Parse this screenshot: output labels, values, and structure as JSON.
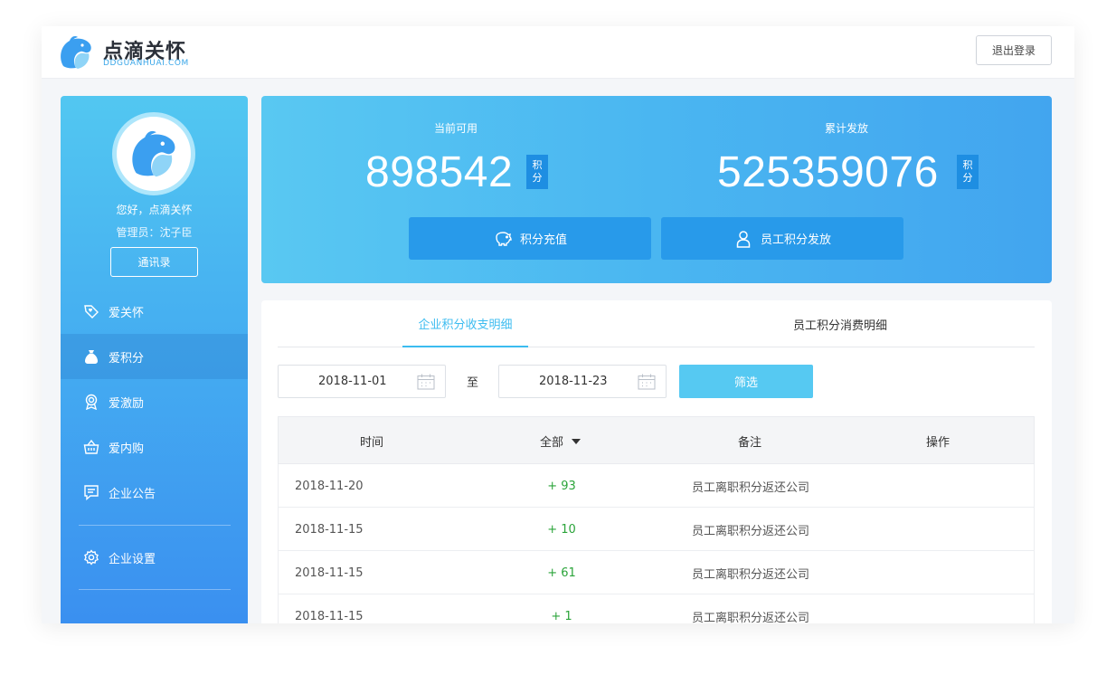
{
  "brand": {
    "name": "点滴关怀",
    "domain": "DDGUANHUAI.COM"
  },
  "header": {
    "logout_label": "退出登录"
  },
  "sidebar": {
    "greeting": "您好，点滴关怀",
    "admin": "管理员：沈子臣",
    "contacts_label": "通讯录",
    "items": [
      {
        "label": "爱关怀",
        "icon": "heart-tag-icon"
      },
      {
        "label": "爱积分",
        "icon": "money-bag-icon"
      },
      {
        "label": "爱激励",
        "icon": "medal-icon"
      },
      {
        "label": "爱内购",
        "icon": "basket-icon"
      },
      {
        "label": "企业公告",
        "icon": "notice-icon"
      },
      {
        "label": "企业设置",
        "icon": "gear-icon"
      }
    ],
    "active_index": 1
  },
  "stats": {
    "available_label": "当前可用",
    "available_value": "898542",
    "issued_label": "累计发放",
    "issued_value": "525359076",
    "unit_top": "积",
    "unit_bottom": "分",
    "recharge_label": "积分充值",
    "distribute_label": "员工积分发放"
  },
  "tabs": [
    {
      "label": "企业积分收支明细",
      "active": true
    },
    {
      "label": "员工积分消费明细",
      "active": false
    }
  ],
  "filter": {
    "start_date": "2018-11-01",
    "separator": "至",
    "end_date": "2018-11-23",
    "button_label": "筛选"
  },
  "table": {
    "headers": {
      "time": "时间",
      "type": "全部",
      "note": "备注",
      "action": "操作"
    },
    "rows": [
      {
        "time": "2018-11-20",
        "amount": "+ 93",
        "note": "员工离职积分返还公司"
      },
      {
        "time": "2018-11-15",
        "amount": "+ 10",
        "note": "员工离职积分返还公司"
      },
      {
        "time": "2018-11-15",
        "amount": "+ 61",
        "note": "员工离职积分返还公司"
      },
      {
        "time": "2018-11-15",
        "amount": "+ 1",
        "note": "员工离职积分返还公司"
      }
    ]
  },
  "colors": {
    "accent": "#3cbcf0",
    "positive": "#2ba43a",
    "button_dark": "#289aea"
  }
}
